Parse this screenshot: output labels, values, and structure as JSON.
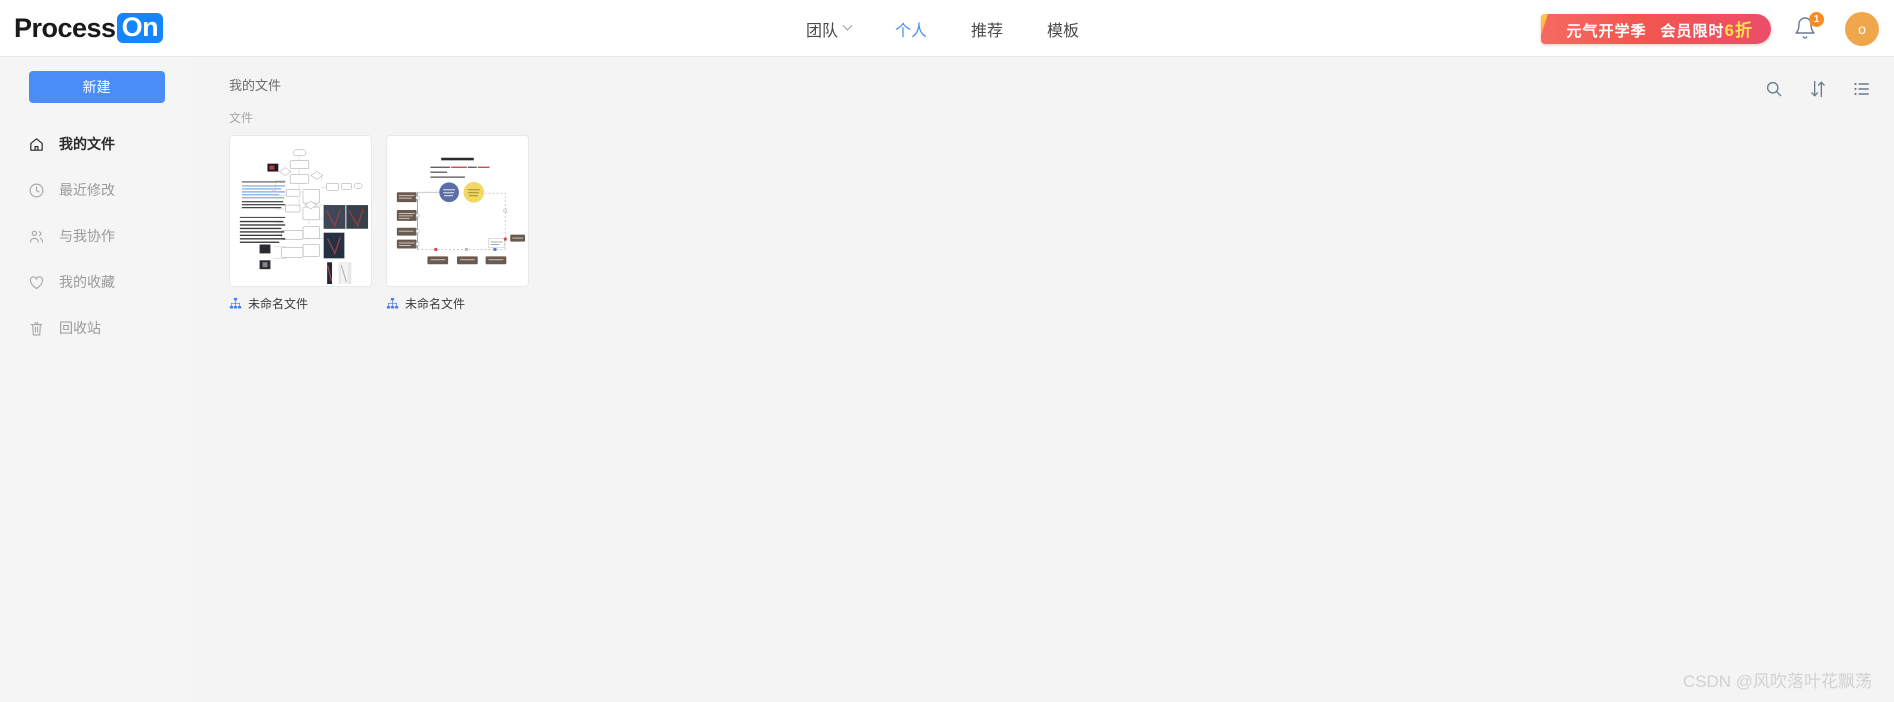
{
  "brand": {
    "name_dark": "Process",
    "name_light": "On"
  },
  "nav": {
    "items": [
      {
        "label": "团队",
        "has_dropdown": true,
        "active": false
      },
      {
        "label": "个人",
        "has_dropdown": false,
        "active": true
      },
      {
        "label": "推荐",
        "has_dropdown": false,
        "active": false
      },
      {
        "label": "模板",
        "has_dropdown": false,
        "active": false
      }
    ]
  },
  "promo": {
    "text_main": "元气开学季",
    "text_second": "会员限时",
    "text_highlight": "6折",
    "bg_color": "#f2564f",
    "highlight_color": "#ffe14d"
  },
  "notifications": {
    "icon": "bell-icon",
    "count": "1",
    "badge_color": "#ff8b1f"
  },
  "account": {
    "avatar_letter": "o",
    "avatar_color": "#f0a64a"
  },
  "sidebar": {
    "new_button": "新建",
    "new_button_color": "#4a8df6",
    "items": [
      {
        "label": "我的文件",
        "icon": "home-icon",
        "active": true
      },
      {
        "label": "最近修改",
        "icon": "clock-icon",
        "active": false
      },
      {
        "label": "与我协作",
        "icon": "people-icon",
        "active": false
      },
      {
        "label": "我的收藏",
        "icon": "heart-icon",
        "active": false
      },
      {
        "label": "回收站",
        "icon": "trash-icon",
        "active": false
      }
    ]
  },
  "main": {
    "breadcrumb": "我的文件",
    "section_label": "文件",
    "toolbar": [
      {
        "name": "search-icon",
        "label": "搜索"
      },
      {
        "name": "sort-icon",
        "label": "排序"
      },
      {
        "name": "list-view-icon",
        "label": "列表视图"
      }
    ],
    "files": [
      {
        "name": "未命名文件",
        "icon": "flowchart-icon",
        "thumb_type": "flowchart"
      },
      {
        "name": "未命名文件",
        "icon": "flowchart-icon",
        "thumb_type": "plan-diagram"
      }
    ]
  },
  "watermark": {
    "text": "CSDN @风吹落叶花飘荡"
  }
}
